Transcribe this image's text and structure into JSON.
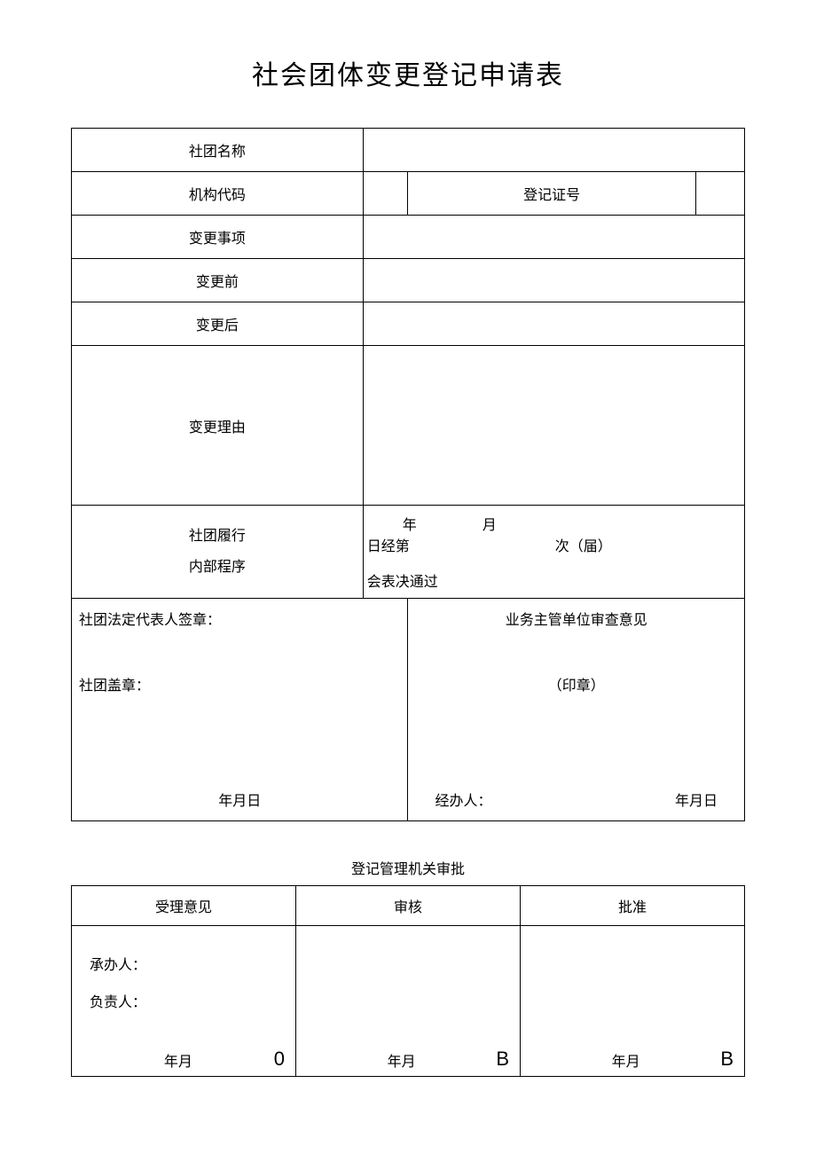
{
  "title": "社会团体变更登记申请表",
  "table1": {
    "label_org_name": "社团名称",
    "label_org_code": "机构代码",
    "label_reg_no": "登记证号",
    "label_change_item": "变更事项",
    "label_before": "变更前",
    "label_after": "变更后",
    "label_reason": "变更理由",
    "label_proc1": "社团履行",
    "label_proc2": "内部程序",
    "proc_year": "年",
    "proc_month": "月",
    "proc_day_prefix": "日经第",
    "proc_ci": "次（届）",
    "proc_line2": "会表决通过",
    "legal_sign": "社团法定代表人签章：",
    "org_seal": "社团盖章：",
    "review_opinion": "业务主管单位审查意见",
    "seal_text": "（印章）",
    "handler": "经办人：",
    "date_ymd": "年月日"
  },
  "subtitle": "登记管理机关审批",
  "table2": {
    "h_accept": "受理意见",
    "h_review": "审核",
    "h_approve": "批准",
    "handler": "承办人：",
    "responsible": "负责人：",
    "ym": "年月",
    "marker_0": "0",
    "marker_b": "B"
  }
}
